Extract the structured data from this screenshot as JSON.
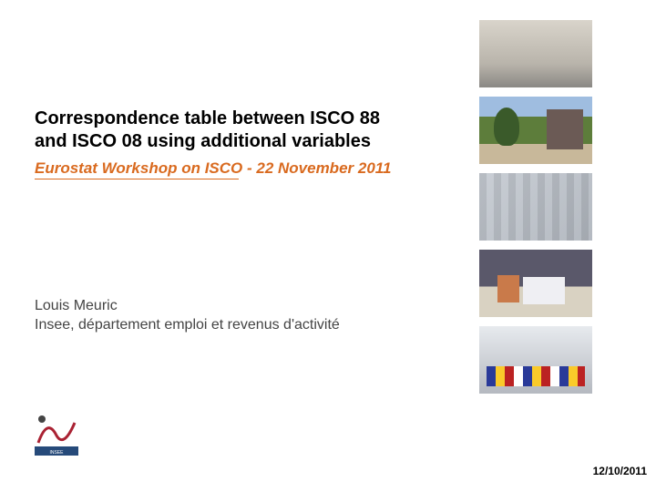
{
  "title": "Correspondence table between ISCO 88 and ISCO 08 using additional variables",
  "subtitle": "Eurostat Workshop on ISCO - 22 November 2011",
  "author_line1": "Louis Meuric",
  "author_line2": "Insee, département emploi et revenus d'activité",
  "logo_text": "INSEE",
  "date": "12/10/2011"
}
